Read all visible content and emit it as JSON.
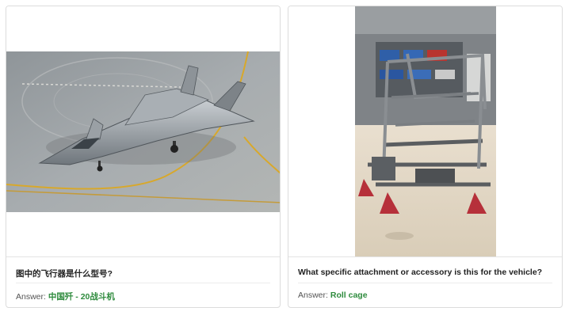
{
  "cards": [
    {
      "question": "图中的飞行器是什么型号?",
      "answer_label": "Answer:",
      "answer_value": "中国歼 - 20战斗机",
      "image": "fighter-jet-on-tarmac"
    },
    {
      "question": "What specific attachment or accessory is this for the vehicle?",
      "answer_label": "Answer:",
      "answer_value": "Roll cage",
      "image": "vehicle-chassis-roll-cage-in-garage"
    }
  ],
  "colors": {
    "answer_accent": "#2e8b3d",
    "card_border": "#dcdcdc"
  }
}
